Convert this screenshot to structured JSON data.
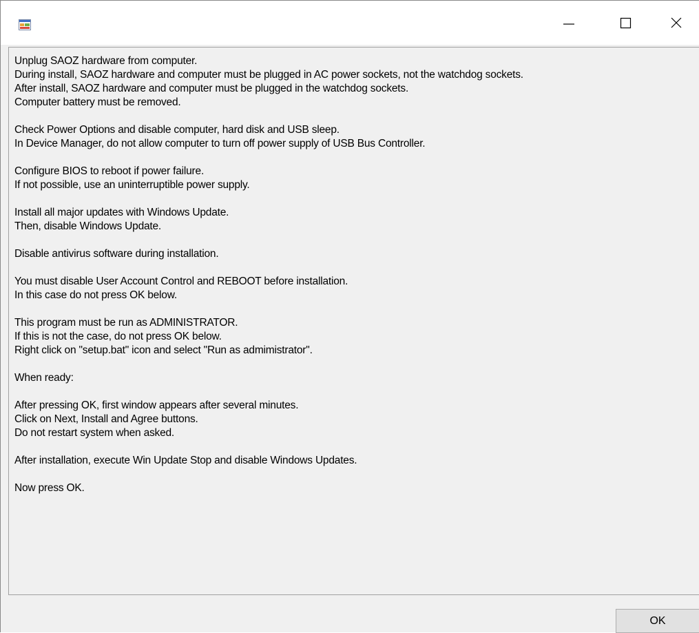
{
  "window": {
    "title": "",
    "app_icon": "windows-form-icon",
    "controls": {
      "minimize_icon": "minimize-icon",
      "maximize_icon": "maximize-icon",
      "close_icon": "close-icon"
    }
  },
  "instructions": {
    "blocks": [
      [
        "Unplug SAOZ hardware from computer.",
        "During install, SAOZ hardware and computer must be plugged in AC power sockets, not the watchdog sockets.",
        "After install, SAOZ hardware and computer must be plugged in the watchdog sockets.",
        "Computer battery must be removed."
      ],
      [
        "Check Power Options and disable computer, hard disk and USB sleep.",
        "In Device Manager, do not allow computer to turn off power supply of USB Bus Controller."
      ],
      [
        "Configure BIOS to reboot if power failure.",
        "If not possible, use an uninterruptible power supply."
      ],
      [
        "Install all major updates with Windows Update.",
        "Then, disable Windows Update."
      ],
      [
        "Disable antivirus software during installation."
      ],
      [
        "You must disable User Account Control and REBOOT before installation.",
        "In this case do not press OK below."
      ],
      [
        "This program must be run as ADMINISTRATOR.",
        "If this is not the case, do not press OK below.",
        "Right click on \"setup.bat\" icon and select \"Run as admimistrator\"."
      ],
      [
        "When ready:"
      ],
      [
        "After pressing OK, first window appears after several minutes.",
        "Click on Next, Install and Agree buttons.",
        "Do not restart system when asked."
      ],
      [
        "After installation, execute Win Update Stop and disable Windows Updates."
      ],
      [
        "Now press OK."
      ]
    ]
  },
  "ok_button": {
    "label": "OK"
  }
}
